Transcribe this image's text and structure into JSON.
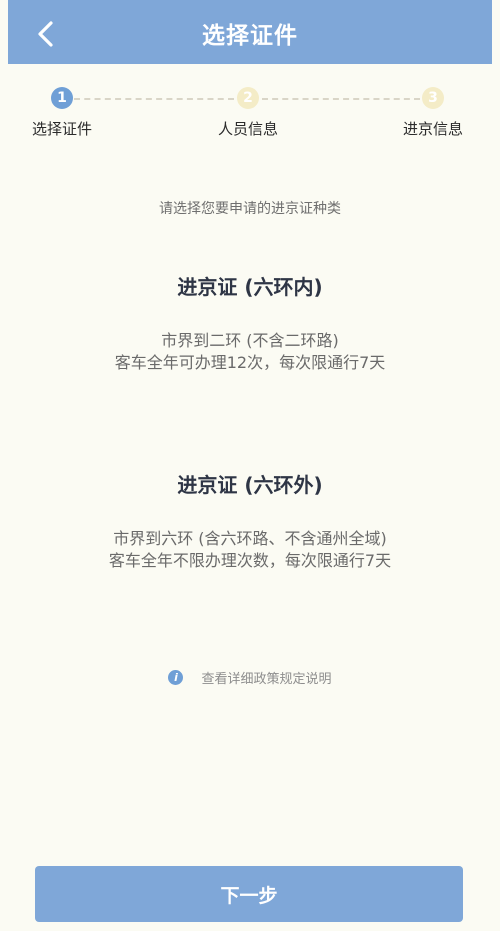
{
  "header": {
    "title": "选择证件",
    "back_icon": "chevron-left-icon"
  },
  "steps": [
    {
      "number": "1",
      "label": "选择证件",
      "active": true
    },
    {
      "number": "2",
      "label": "人员信息",
      "active": false
    },
    {
      "number": "3",
      "label": "进京信息",
      "active": false
    }
  ],
  "prompt": "请选择您要申请的进京证种类",
  "options": [
    {
      "title": "进京证 (六环内)",
      "desc_line1": "市界到二环 (不含二环路)",
      "desc_line2": "客车全年可办理12次，每次限通行7天"
    },
    {
      "title": "进京证 (六环外)",
      "desc_line1": "市界到六环 (含六环路、不含通州全域)",
      "desc_line2": "客车全年不限办理次数，每次限通行7天"
    }
  ],
  "info": {
    "icon_char": "i",
    "text": "查看详细政策规定说明"
  },
  "next_button": "下一步",
  "colors": {
    "primary": "#7fa7d8",
    "step_active": "#6f9fd6",
    "step_inactive": "#f4ecc7",
    "background": "#fbfbf3"
  }
}
